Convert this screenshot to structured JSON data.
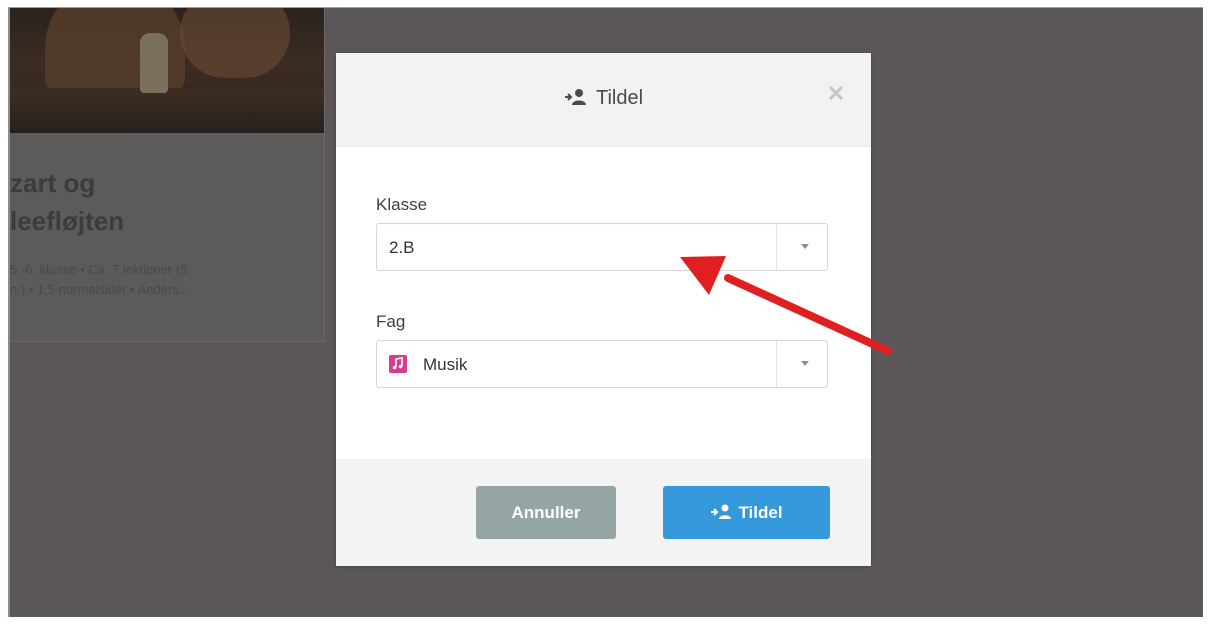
{
  "background_card": {
    "title": "zart og\nleefløjten",
    "meta": "5.-6. klasse • Ca. 7 lektioner (5\nn.) • 1,5 normalsider • Anders..."
  },
  "modal": {
    "title": "Tildel",
    "header_icon": "assign-user-icon",
    "close_icon": "close-icon",
    "fields": {
      "klasse": {
        "label": "Klasse",
        "value": "2.B"
      },
      "fag": {
        "label": "Fag",
        "value": "Musik",
        "icon": "music-icon",
        "icon_color": "#d63d8e"
      }
    },
    "buttons": {
      "cancel": "Annuller",
      "assign": "Tildel"
    }
  },
  "colors": {
    "overlay": "#5b5758",
    "cancel_button": "#95a5a6",
    "assign_button": "#3498db",
    "annotation_arrow": "#e02020"
  }
}
